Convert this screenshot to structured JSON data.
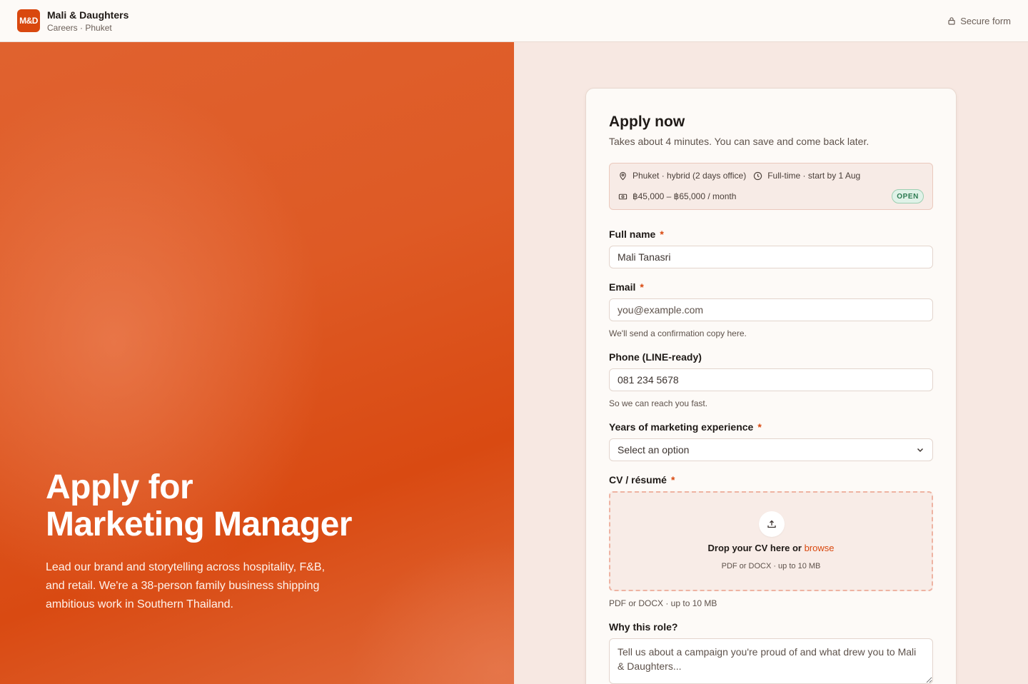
{
  "header": {
    "logo_text": "M&D",
    "company": "Mali & Daughters",
    "subtitle": "Careers · Phuket",
    "secure_label": "Secure form"
  },
  "hero": {
    "title_line1": "Apply for",
    "title_line2": "Marketing Manager",
    "description": "Lead our brand and storytelling across hospitality, F&B, and retail. We're a 38-person family business shipping ambitious work in Southern Thailand."
  },
  "form": {
    "title": "Apply now",
    "subtitle": "Takes about 4 minutes. You can save and come back later.",
    "info": {
      "location": "Phuket · hybrid (2 days office)",
      "schedule": "Full-time · start by 1 Aug",
      "salary": "฿45,000 – ฿65,000 / month",
      "status": "OPEN"
    },
    "full_name": {
      "label": "Full name",
      "required_mark": "*",
      "value": "Mali Tanasri"
    },
    "email": {
      "label": "Email",
      "required_mark": "*",
      "placeholder": "you@example.com",
      "help": "We'll send a confirmation copy here."
    },
    "phone": {
      "label": "Phone (LINE-ready)",
      "value": "081 234 5678",
      "help": "So we can reach you fast."
    },
    "experience": {
      "label": "Years of marketing experience",
      "required_mark": "*",
      "selected": "Select an option"
    },
    "cv": {
      "label": "CV / résumé",
      "required_mark": "*",
      "drop_text": "Drop your CV here or ",
      "browse": "browse",
      "drop_hint": "PDF or DOCX · up to 10 MB",
      "help": "PDF or DOCX · up to 10 MB"
    },
    "why": {
      "label": "Why this role?",
      "placeholder": "Tell us about a campaign you're proud of and what drew you to Mali & Daughters..."
    }
  },
  "colors": {
    "accent": "#d9480f",
    "status_green": "#2d7a52"
  }
}
